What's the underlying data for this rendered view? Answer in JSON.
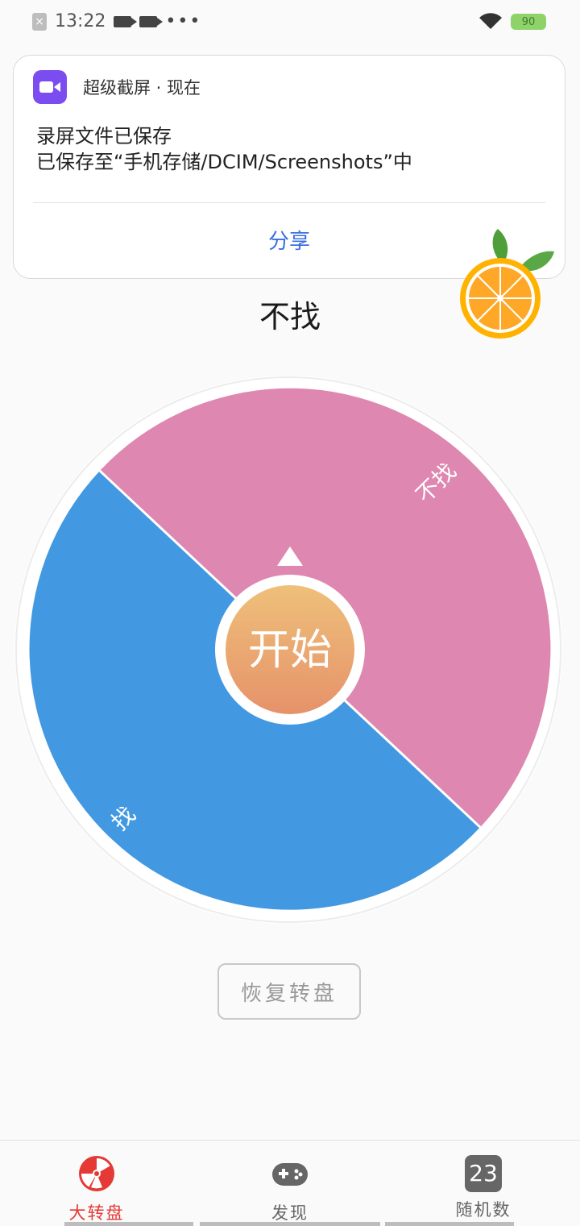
{
  "status_bar": {
    "time": "13:22",
    "dots": "•••",
    "battery": "90"
  },
  "notification": {
    "app_name": "超级截屏 · 现在",
    "title": "录屏文件已保存",
    "body": "已保存至“手机存储/DCIM/Screenshots”中",
    "action": "分享"
  },
  "result_text": "不找",
  "wheel": {
    "segments": [
      {
        "label": "不找",
        "color": "#de87b0"
      },
      {
        "label": "找",
        "color": "#4299e1"
      }
    ],
    "start_label": "开始"
  },
  "restore_button": "恢复转盘",
  "nav": {
    "items": [
      {
        "label": "大转盘",
        "active": true
      },
      {
        "label": "发现",
        "active": false
      },
      {
        "label": "随机数",
        "active": false,
        "icon_text": "23"
      }
    ]
  },
  "colors": {
    "accent": "#e53935",
    "link": "#3a6fe0",
    "start_button": "#e8945e"
  }
}
